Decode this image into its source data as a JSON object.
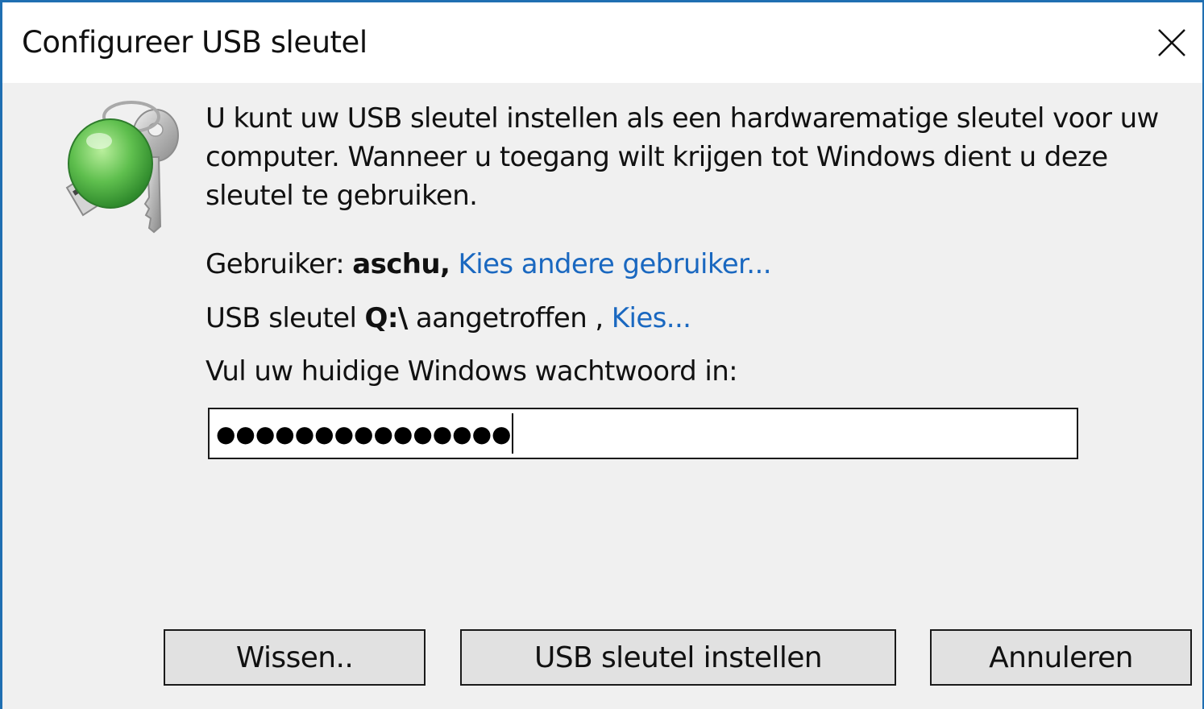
{
  "window": {
    "title": "Configureer USB sleutel"
  },
  "icon": {
    "name": "usb-key-icon"
  },
  "intro_text": "U kunt uw USB sleutel instellen als een hardwarematige sleutel voor uw computer. Wanneer u toegang wilt krijgen tot Windows dient u deze sleutel te gebruiken.",
  "user_line": {
    "label": "Gebruiker: ",
    "username": "aschu,",
    "link": "Kies andere gebruiker..."
  },
  "usb_line": {
    "prefix": "USB sleutel ",
    "drive": "Q:\\",
    "suffix": " aangetroffen , ",
    "link": "Kies..."
  },
  "password": {
    "label": "Vul uw huidige Windows wachtwoord in:",
    "masked_value": "●●●●●●●●●●●●●●●"
  },
  "buttons": {
    "clear": "Wissen..",
    "set": "USB sleutel instellen",
    "cancel": "Annuleren"
  },
  "colors": {
    "title_border": "#1f6fb2",
    "link": "#1a68c0",
    "background": "#f0f0f0"
  }
}
